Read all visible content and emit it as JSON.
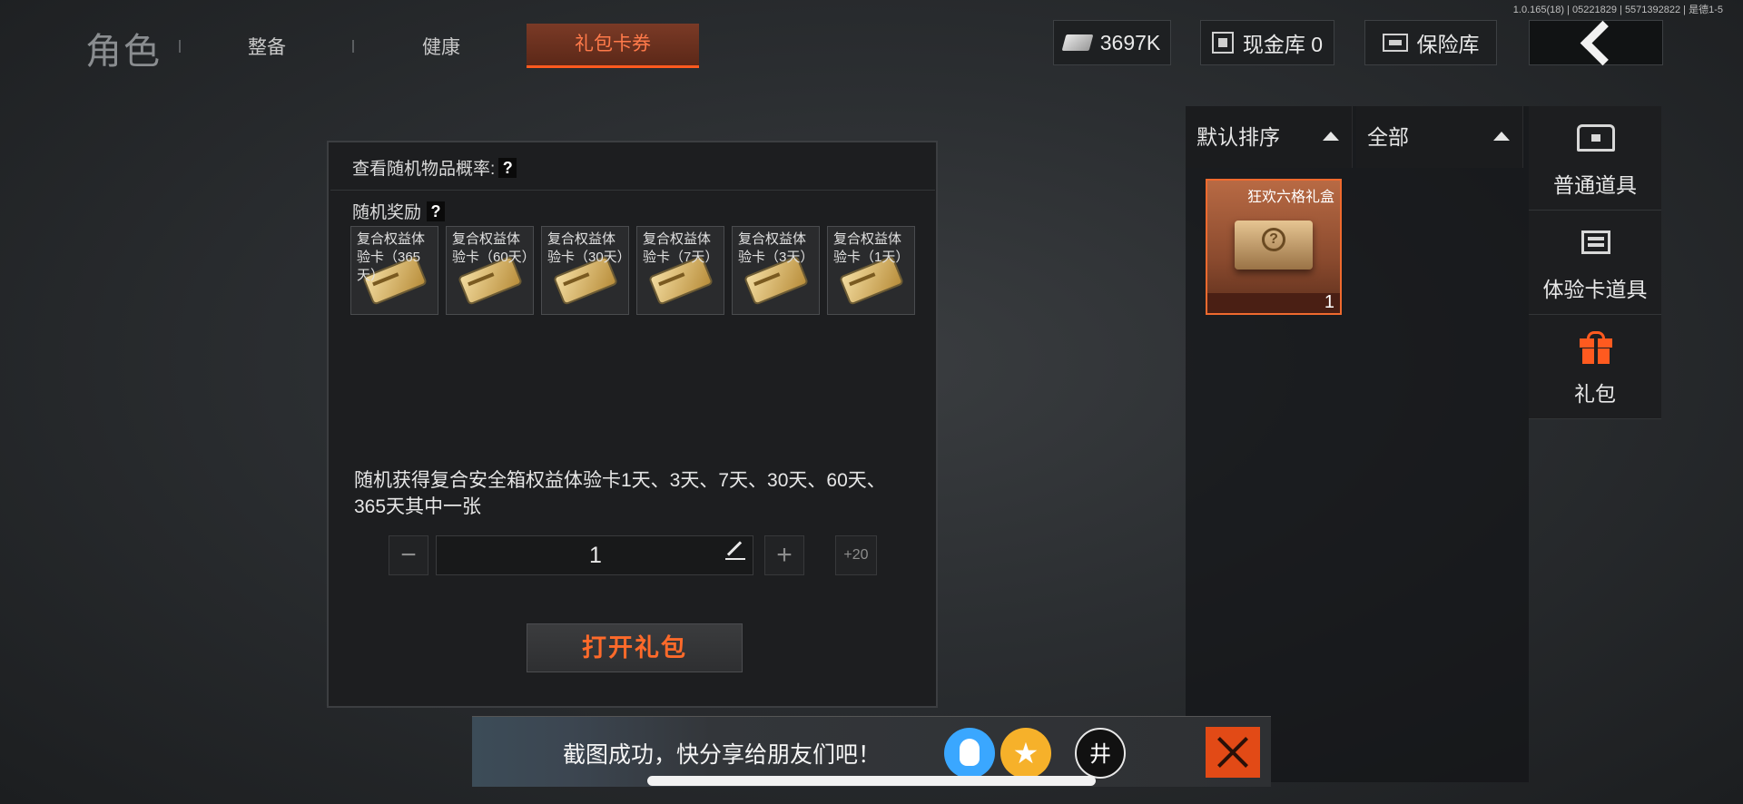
{
  "version": "1.0.165(18) | 05221829 | 5571392822 | 是德1-5",
  "header": {
    "title": "角色",
    "tabs": [
      {
        "label": "整备"
      },
      {
        "label": "健康"
      },
      {
        "label": "礼包卡券"
      }
    ],
    "active_tab": "礼包卡券",
    "currency": {
      "value": "3697K",
      "icon": "ticket-icon"
    },
    "cash_vault": {
      "label": "现金库 0",
      "icon": "cash-vault-icon"
    },
    "safe": {
      "label": "保险库",
      "icon": "safe-icon"
    },
    "back": {
      "icon": "chevron-left-icon"
    }
  },
  "dialog": {
    "probability_label": "查看随机物品概率:",
    "reward_label": "随机奖励",
    "help_glyph": "?",
    "rewards": [
      {
        "name": "复合权益体验卡（365天）"
      },
      {
        "name": "复合权益体验卡（60天）"
      },
      {
        "name": "复合权益体验卡（30天）"
      },
      {
        "name": "复合权益体验卡（7天）"
      },
      {
        "name": "复合权益体验卡（3天）"
      },
      {
        "name": "复合权益体验卡（1天）"
      }
    ],
    "description": "随机获得复合安全箱权益体验卡1天、3天、7天、30天、60天、365天其中一张",
    "quantity": "1",
    "minus": "−",
    "plus": "+",
    "plus20": "+20",
    "open_button": "打开礼包"
  },
  "inventory": {
    "sort_label": "默认排序",
    "filter_label": "全部",
    "items": [
      {
        "name": "狂欢六格礼盒",
        "count": "1",
        "emblem": "?"
      }
    ]
  },
  "categories": [
    {
      "label": "普通道具",
      "icon": "chest-icon"
    },
    {
      "label": "体验卡道具",
      "icon": "card-icon"
    },
    {
      "label": "礼包",
      "icon": "gift-icon",
      "active": true
    }
  ],
  "toast": {
    "text": "截图成功，快分享给朋友们吧！",
    "wx_glyph": "井",
    "star_glyph": "★"
  },
  "colors": {
    "accent": "#ff5a1f",
    "item_border": "#f06a2e"
  }
}
